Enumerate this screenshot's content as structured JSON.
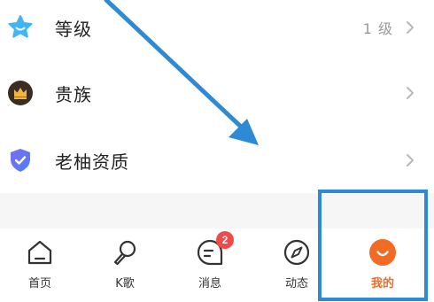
{
  "menu": {
    "items": [
      {
        "icon": "blue-star-icon",
        "label": "等级",
        "value": "1 级"
      },
      {
        "icon": "crown-icon",
        "label": "贵族",
        "value": ""
      },
      {
        "icon": "shield-check-icon",
        "label": "老柚资质",
        "value": ""
      }
    ]
  },
  "tabbar": {
    "tabs": [
      {
        "icon": "home-icon",
        "label": "首页"
      },
      {
        "icon": "microphone-icon",
        "label": "K歌"
      },
      {
        "icon": "message-icon",
        "label": "消息",
        "badge": "2"
      },
      {
        "icon": "compass-icon",
        "label": "动态"
      },
      {
        "icon": "smile-avatar-icon",
        "label": "我的"
      }
    ],
    "active_tab": "我的"
  },
  "colors": {
    "accent": "#f26b25",
    "badge": "#f04a4a",
    "annotation": "#2f8ad6",
    "separator": "#f6f6f6"
  }
}
